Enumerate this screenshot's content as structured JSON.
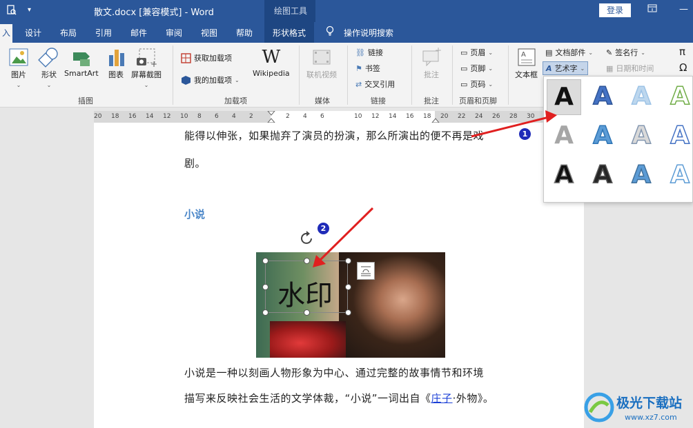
{
  "titlebar": {
    "title": "散文.docx [兼容模式]  -  Word",
    "context_group": "绘图工具",
    "login": "登录"
  },
  "tabs": [
    {
      "label": "入",
      "active": true
    },
    {
      "label": "设计"
    },
    {
      "label": "布局"
    },
    {
      "label": "引用"
    },
    {
      "label": "邮件"
    },
    {
      "label": "审阅"
    },
    {
      "label": "视图"
    },
    {
      "label": "帮助"
    },
    {
      "label": "形状格式",
      "contextual": true
    },
    {
      "label": "操作说明搜索"
    }
  ],
  "ribbon": {
    "illustrations": {
      "label": "插图",
      "picture": "图片",
      "shapes": "形状",
      "smartart": "SmartArt",
      "chart": "图表",
      "screenshot": "屏幕截图"
    },
    "addins": {
      "label": "加载项",
      "get": "获取加载项",
      "my": "我的加载项",
      "wikipedia": "Wikipedia"
    },
    "media": {
      "label": "媒体",
      "video": "联机视频"
    },
    "links": {
      "label": "链接",
      "link": "链接",
      "bookmark": "书签",
      "crossref": "交叉引用"
    },
    "comments": {
      "label": "批注",
      "comment": "批注"
    },
    "headerfooter": {
      "label": "页眉和页脚",
      "header": "页眉",
      "footer": "页脚",
      "pagenum": "页码"
    },
    "text": {
      "textbox": "文本框",
      "quickparts": "文档部件",
      "wordart": "艺术字",
      "signature": "签名行",
      "datetime": "日期和时间"
    },
    "symbols": {
      "pi": "π",
      "omega": "Ω"
    }
  },
  "ruler": {
    "left_ticks": [
      "20",
      "18",
      "16",
      "14",
      "12",
      "10",
      "8",
      "6",
      "4",
      "2"
    ],
    "white_ticks": [
      "2",
      "4",
      "6"
    ],
    "right_ticks": [
      "10",
      "12",
      "14",
      "16",
      "18",
      "20",
      "22",
      "24",
      "26",
      "28",
      "30"
    ]
  },
  "document": {
    "line1": "能得以伸张，如果抛弃了演员的扮演，那么所演出的便不再是戏",
    "line2": "剧。",
    "heading": "小说",
    "watermark_text": "水印",
    "para2_line1": "小说是一种以刻画人物形象为中心、通过完整的故事情节和环境",
    "para2_line2_pre": "描写来反映社会生活的文学体裁，“小说”一词出自《",
    "para2_link": "庄子",
    "para2_line2_post": "·外物》。"
  },
  "wordart_gallery": {
    "glyph": "A",
    "styles": [
      {
        "fill": "#111111",
        "stroke": "none"
      },
      {
        "fill": "#4472c4",
        "stroke": "#2f5597"
      },
      {
        "fill": "#bdd7ee",
        "stroke": "#9dc3e6"
      },
      {
        "fill": "#ffffff",
        "stroke": "#70ad47"
      },
      {
        "fill": "#a6a6a6",
        "stroke": "none"
      },
      {
        "fill": "#5b9bd5",
        "stroke": "#2e75b6"
      },
      {
        "fill": "#d9d9d9",
        "stroke": "#8497b0"
      },
      {
        "fill": "#ffffff",
        "stroke": "#4472c4"
      },
      {
        "fill": "#111111",
        "stroke": "#7f7f7f"
      },
      {
        "fill": "#262626",
        "stroke": "#595959"
      },
      {
        "fill": "#5b9bd5",
        "stroke": "#41719c"
      },
      {
        "fill": "#ffffff",
        "stroke": "#5b9bd5"
      }
    ]
  },
  "callouts": {
    "one": "1",
    "two": "2"
  },
  "site_watermark": {
    "name": "极光下载站",
    "url": "www.xz7.com"
  },
  "colors": {
    "ribbon_blue": "#2b579a",
    "arrow_red": "#e02020",
    "heading_blue": "#4a86c8",
    "badge_blue": "#1f2bb8"
  }
}
